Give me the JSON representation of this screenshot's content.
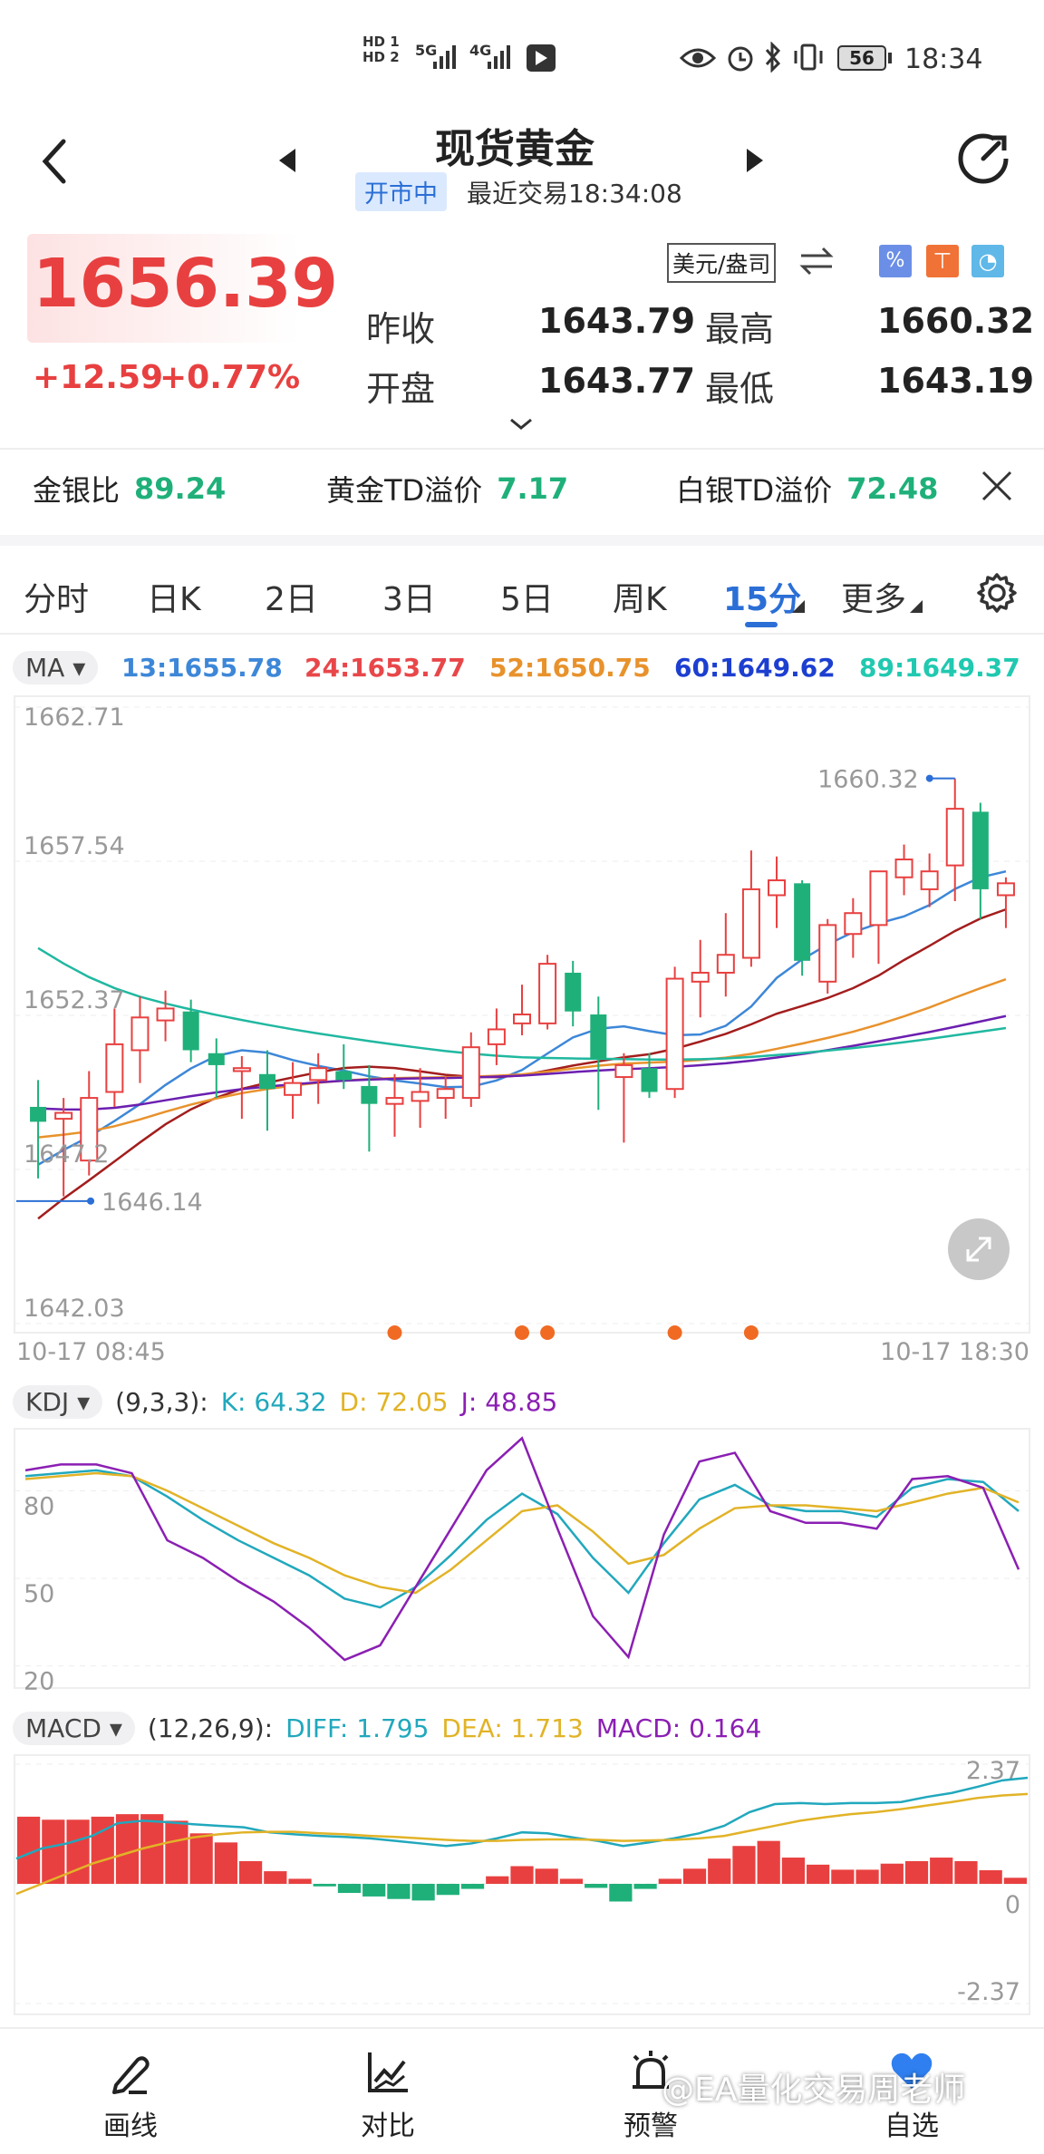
{
  "status_bar": {
    "time": "18:34",
    "battery": "56",
    "net1": "5G",
    "net2": "4G",
    "hd1": "HD 1",
    "hd2": "HD 2"
  },
  "header": {
    "title": "现货黄金",
    "status_badge": "开市中",
    "last_trade": "最近交易18:34:08"
  },
  "quote": {
    "price": "1656.39",
    "change": "+12.59",
    "change_pct": "+0.77%",
    "unit": "美元/盎司",
    "prev_close_label": "昨收",
    "prev_close": "1643.79",
    "open_label": "开盘",
    "open": "1643.77",
    "high_label": "最高",
    "high": "1660.32",
    "low_label": "最低",
    "low": "1643.19"
  },
  "ratios": [
    {
      "label": "金银比",
      "value": "89.24"
    },
    {
      "label": "黄金TD溢价",
      "value": "7.17"
    },
    {
      "label": "白银TD溢价",
      "value": "72.48"
    }
  ],
  "tabs": [
    "分时",
    "日K",
    "2日",
    "3日",
    "5日",
    "周K",
    "15分",
    "更多"
  ],
  "active_tab": "15分",
  "ma_panel": {
    "label": "MA",
    "values": [
      {
        "text": "13:1655.78",
        "color": "#3d87d8"
      },
      {
        "text": "24:1653.77",
        "color": "#e8474a"
      },
      {
        "text": "52:1650.75",
        "color": "#e8922c"
      },
      {
        "text": "60:1649.62",
        "color": "#1c3fd0"
      },
      {
        "text": "89:1649.37",
        "color": "#20c9b0"
      }
    ]
  },
  "colors": {
    "up": "#e84040",
    "down": "#1fb07a",
    "accent": "#2b6fd6"
  },
  "chart_data": [
    {
      "type": "candlestick",
      "y_ticks": [
        "1662.71",
        "1657.54",
        "1652.37",
        "1647.2",
        "1642.03"
      ],
      "ylim": [
        1642.03,
        1662.71
      ],
      "x_start_label": "10-17 08:45",
      "x_end_label": "10-17 18:30",
      "max_annotation": "1660.32",
      "min_annotation": "1646.14",
      "candles": [
        {
          "o": 1649.3,
          "h": 1650.2,
          "l": 1646.9,
          "c": 1648.8
        },
        {
          "o": 1648.9,
          "h": 1649.6,
          "l": 1646.3,
          "c": 1649.1
        },
        {
          "o": 1647.5,
          "h": 1650.5,
          "l": 1647.0,
          "c": 1649.6
        },
        {
          "o": 1649.8,
          "h": 1652.6,
          "l": 1649.3,
          "c": 1651.4
        },
        {
          "o": 1651.2,
          "h": 1653.0,
          "l": 1650.1,
          "c": 1652.3
        },
        {
          "o": 1652.2,
          "h": 1653.2,
          "l": 1651.5,
          "c": 1652.6
        },
        {
          "o": 1652.5,
          "h": 1652.9,
          "l": 1650.8,
          "c": 1651.2
        },
        {
          "o": 1651.1,
          "h": 1651.6,
          "l": 1649.6,
          "c": 1650.7
        },
        {
          "o": 1650.5,
          "h": 1651.0,
          "l": 1648.9,
          "c": 1650.6
        },
        {
          "o": 1650.4,
          "h": 1651.2,
          "l": 1648.5,
          "c": 1649.9
        },
        {
          "o": 1649.7,
          "h": 1650.8,
          "l": 1648.9,
          "c": 1650.1
        },
        {
          "o": 1650.2,
          "h": 1651.1,
          "l": 1649.4,
          "c": 1650.6
        },
        {
          "o": 1650.5,
          "h": 1651.4,
          "l": 1649.9,
          "c": 1650.2
        },
        {
          "o": 1650.0,
          "h": 1650.7,
          "l": 1647.8,
          "c": 1649.4
        },
        {
          "o": 1649.4,
          "h": 1650.4,
          "l": 1648.3,
          "c": 1649.6
        },
        {
          "o": 1649.5,
          "h": 1650.6,
          "l": 1648.6,
          "c": 1649.8
        },
        {
          "o": 1649.6,
          "h": 1650.3,
          "l": 1648.9,
          "c": 1649.9
        },
        {
          "o": 1649.6,
          "h": 1651.8,
          "l": 1649.3,
          "c": 1651.3
        },
        {
          "o": 1651.4,
          "h": 1652.6,
          "l": 1650.7,
          "c": 1651.9
        },
        {
          "o": 1652.1,
          "h": 1653.4,
          "l": 1651.7,
          "c": 1652.4
        },
        {
          "o": 1652.1,
          "h": 1654.4,
          "l": 1651.9,
          "c": 1654.1
        },
        {
          "o": 1653.8,
          "h": 1654.2,
          "l": 1652.0,
          "c": 1652.5
        },
        {
          "o": 1652.4,
          "h": 1653.0,
          "l": 1649.2,
          "c": 1650.9
        },
        {
          "o": 1650.3,
          "h": 1651.1,
          "l": 1648.1,
          "c": 1650.7
        },
        {
          "o": 1650.6,
          "h": 1651.1,
          "l": 1649.6,
          "c": 1649.8
        },
        {
          "o": 1649.9,
          "h": 1654.0,
          "l": 1649.6,
          "c": 1653.6
        },
        {
          "o": 1653.5,
          "h": 1654.9,
          "l": 1652.3,
          "c": 1653.8
        },
        {
          "o": 1653.8,
          "h": 1655.8,
          "l": 1653.0,
          "c": 1654.4
        },
        {
          "o": 1654.3,
          "h": 1657.9,
          "l": 1654.0,
          "c": 1656.6
        },
        {
          "o": 1656.4,
          "h": 1657.7,
          "l": 1655.3,
          "c": 1656.9
        },
        {
          "o": 1656.8,
          "h": 1656.9,
          "l": 1653.7,
          "c": 1654.2
        },
        {
          "o": 1653.5,
          "h": 1655.6,
          "l": 1653.1,
          "c": 1655.4
        },
        {
          "o": 1655.1,
          "h": 1656.3,
          "l": 1654.3,
          "c": 1655.8
        },
        {
          "o": 1655.4,
          "h": 1657.0,
          "l": 1654.1,
          "c": 1657.2
        },
        {
          "o": 1657.0,
          "h": 1658.1,
          "l": 1656.4,
          "c": 1657.6
        },
        {
          "o": 1656.6,
          "h": 1657.8,
          "l": 1656.0,
          "c": 1657.2
        },
        {
          "o": 1657.4,
          "h": 1660.32,
          "l": 1656.2,
          "c": 1659.3
        },
        {
          "o": 1659.2,
          "h": 1659.5,
          "l": 1655.6,
          "c": 1656.6
        },
        {
          "o": 1656.4,
          "h": 1657.0,
          "l": 1655.3,
          "c": 1656.8
        }
      ],
      "event_markers_at_index": [
        14,
        19,
        20,
        25,
        28
      ]
    },
    {
      "type": "line",
      "indicator_label": "KDJ",
      "params": "(9,3,3):",
      "k_text": "K: 64.32",
      "d_text": "D: 72.05",
      "j_text": "J: 48.85",
      "y_ticks": [
        "80",
        "50",
        "20"
      ],
      "ylim": [
        18,
        105
      ],
      "series": [
        {
          "name": "K",
          "color": "#21a8bd",
          "values": [
            90,
            91,
            92,
            90,
            83,
            75,
            68,
            62,
            56,
            48,
            45,
            52,
            63,
            75,
            84,
            77,
            62,
            50,
            67,
            82,
            87,
            80,
            78,
            78,
            76,
            86,
            89,
            88,
            78
          ]
        },
        {
          "name": "D",
          "color": "#e2b327",
          "values": [
            89,
            90,
            91,
            90,
            85,
            79,
            73,
            67,
            62,
            56,
            52,
            50,
            58,
            68,
            78,
            80,
            71,
            60,
            63,
            72,
            79,
            80,
            80,
            79,
            78,
            81,
            84,
            86,
            81
          ]
        },
        {
          "name": "J",
          "color": "#8b1fb3",
          "values": [
            92,
            94,
            94,
            91,
            68,
            62,
            54,
            47,
            38,
            27,
            32,
            52,
            72,
            92,
            103,
            72,
            42,
            28,
            70,
            95,
            98,
            78,
            74,
            74,
            72,
            89,
            90,
            86,
            58
          ]
        }
      ]
    },
    {
      "type": "bar",
      "indicator_label": "MACD",
      "params": "(12,26,9):",
      "diff_text": "DIFF: 1.795",
      "dea_text": "DEA: 1.713",
      "macd_text": "MACD: 0.164",
      "y_ticks": [
        "2.37",
        "0",
        "-2.37"
      ],
      "ylim": [
        -2.37,
        2.37
      ],
      "histogram": [
        1.33,
        1.27,
        1.27,
        1.33,
        1.38,
        1.38,
        1.25,
        1.0,
        0.82,
        0.45,
        0.25,
        0.1,
        -0.05,
        -0.18,
        -0.25,
        -0.3,
        -0.33,
        -0.22,
        -0.1,
        0.15,
        0.35,
        0.3,
        0.1,
        -0.08,
        -0.35,
        -0.1,
        0.1,
        0.3,
        0.5,
        0.75,
        0.85,
        0.52,
        0.38,
        0.28,
        0.28,
        0.4,
        0.45,
        0.52,
        0.45,
        0.27,
        0.12
      ],
      "diff_line": [
        0.5,
        0.7,
        0.8,
        0.95,
        1.2,
        1.25,
        1.22,
        1.18,
        1.15,
        1.12,
        1.02,
        0.98,
        0.95,
        0.93,
        0.9,
        0.85,
        0.8,
        0.75,
        0.8,
        0.9,
        1.02,
        1.0,
        0.92,
        0.85,
        0.75,
        0.82,
        0.9,
        1.0,
        1.15,
        1.42,
        1.58,
        1.6,
        1.58,
        1.6,
        1.6,
        1.62,
        1.72,
        1.8,
        1.92,
        2.05,
        2.1
      ],
      "dea_line": [
        -0.2,
        0.0,
        0.2,
        0.4,
        0.55,
        0.7,
        0.82,
        0.92,
        0.98,
        1.02,
        1.03,
        1.03,
        1.0,
        0.98,
        0.95,
        0.93,
        0.9,
        0.87,
        0.85,
        0.85,
        0.87,
        0.88,
        0.88,
        0.87,
        0.85,
        0.86,
        0.87,
        0.9,
        0.95,
        1.05,
        1.15,
        1.25,
        1.32,
        1.38,
        1.42,
        1.48,
        1.55,
        1.62,
        1.7,
        1.75,
        1.78
      ]
    }
  ],
  "bottom_nav": [
    {
      "label": "画线",
      "icon": "pencil-icon"
    },
    {
      "label": "对比",
      "icon": "chart-compare-icon"
    },
    {
      "label": "预警",
      "icon": "alarm-icon"
    },
    {
      "label": "自选",
      "icon": "heart-icon"
    }
  ],
  "watermark": "@EA量化交易周老师"
}
